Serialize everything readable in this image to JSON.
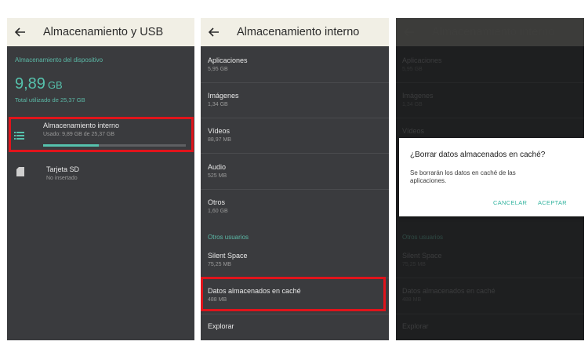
{
  "colors": {
    "accent": "#56c2ad",
    "highlight": "#e0141b",
    "panel": "#3a3b3e",
    "appbar": "#f1efe5"
  },
  "screen1": {
    "title": "Almacenamiento y USB",
    "section_label": "Almacenamiento del dispositivo",
    "used_value": "9,89",
    "used_unit": "GB",
    "total_text": "Total utilizado de 25,37 GB",
    "items": [
      {
        "title": "Almacenamiento interno",
        "subtitle": "Usado: 9,89 GB de 25,37 GB",
        "icon": "storage-list-icon",
        "usage_fraction": 0.39
      },
      {
        "title": "Tarjeta SD",
        "subtitle": "No insertado",
        "icon": "sd-card-icon"
      }
    ]
  },
  "screen2": {
    "title": "Almacenamiento interno",
    "items": [
      {
        "title": "Aplicaciones",
        "subtitle": "5,95 GB"
      },
      {
        "title": "Imágenes",
        "subtitle": "1,34 GB"
      },
      {
        "title": "Vídeos",
        "subtitle": "88,97 MB"
      },
      {
        "title": "Audio",
        "subtitle": "525 MB"
      },
      {
        "title": "Otros",
        "subtitle": "1,60 GB"
      }
    ],
    "section_label": "Otros usuarios",
    "users": [
      {
        "title": "Silent Space",
        "subtitle": "75,25 MB"
      }
    ],
    "cache": {
      "title": "Datos almacenados en caché",
      "subtitle": "488 MB"
    },
    "explore": "Explorar"
  },
  "screen3": {
    "title": "Almacenamiento interno",
    "items": [
      {
        "title": "Aplicaciones",
        "subtitle": "5,95 GB"
      },
      {
        "title": "Imágenes",
        "subtitle": "1,34 GB"
      },
      {
        "title": "Vídeos"
      }
    ],
    "section_label": "Otros usuarios",
    "users": [
      {
        "title": "Silent Space",
        "subtitle": "75,25 MB"
      }
    ],
    "cache": {
      "title": "Datos almacenados en caché",
      "subtitle": "488 MB"
    },
    "explore": "Explorar",
    "dialog": {
      "title": "¿Borrar datos almacenados en caché?",
      "body": "Se borrarán los datos en caché de las aplicaciones.",
      "cancel": "CANCELAR",
      "accept": "ACEPTAR"
    }
  }
}
